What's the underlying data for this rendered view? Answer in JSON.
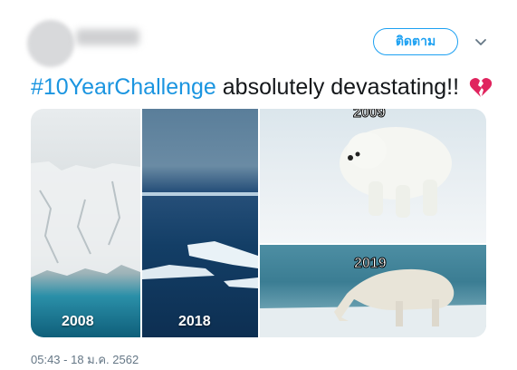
{
  "header": {
    "follow_label": "ติดตาม"
  },
  "tweet": {
    "hashtag": "#10YearChallenge",
    "text": " absolutely devastating!!",
    "emoji_icon": "broken-heart-icon"
  },
  "media": {
    "label_2008": "2008",
    "label_2018": "2018",
    "label_2009": "2009",
    "label_2019": "2019"
  },
  "footer": {
    "timestamp": "05:43 - 18 ม.ค. 2562"
  },
  "colors": {
    "accent": "#1da1f2",
    "hashtag": "#1b95e0",
    "text": "#14171a",
    "muted": "#657786",
    "heart": "#e0245e"
  }
}
